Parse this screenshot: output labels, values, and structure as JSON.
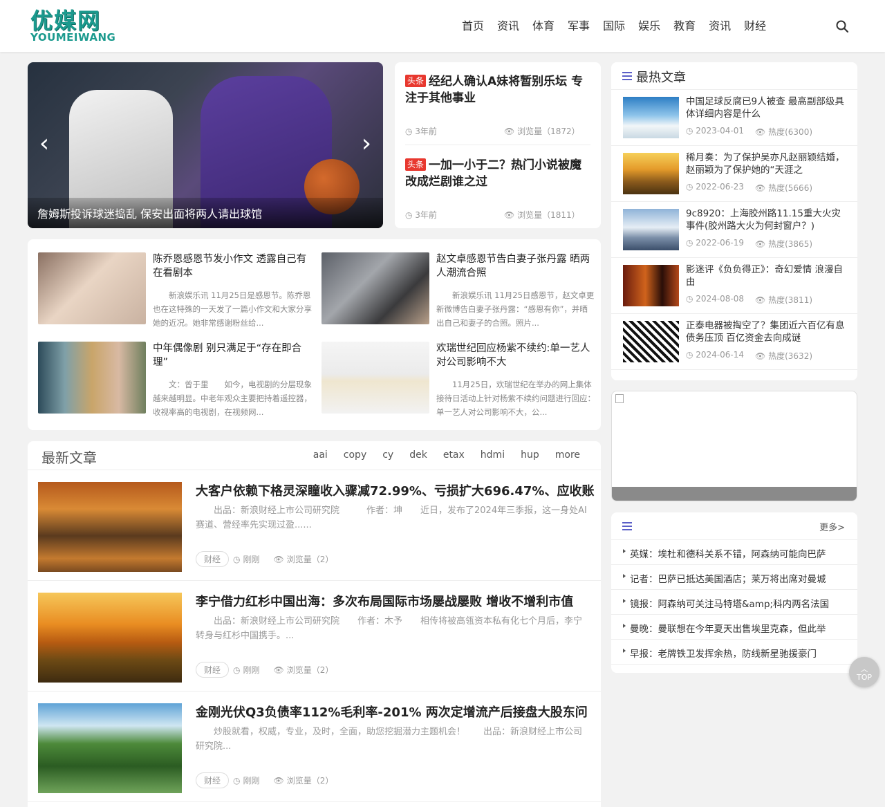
{
  "header": {
    "logo_cn": "优媒网",
    "logo_en": "YOUMEIWANG",
    "nav": [
      "首页",
      "资讯",
      "体育",
      "军事",
      "国际",
      "娱乐",
      "教育",
      "资讯",
      "财经"
    ]
  },
  "slider": {
    "caption": "詹姆斯投诉球迷捣乱 保安出面将两人请出球馆",
    "prev": "‹",
    "next": "›"
  },
  "headlines": [
    {
      "badge": "头条",
      "title": "经纪人确认A妹将暂别乐坛 专注于其他事业",
      "time": "3年前",
      "views": "浏览量（1872）"
    },
    {
      "badge": "头条",
      "title": "一加一小于二？热门小说被魔改成烂剧谁之过",
      "time": "3年前",
      "views": "浏览量（1811）"
    }
  ],
  "grid": [
    {
      "title": "陈乔恩感恩节发小作文 透露自己有在看剧本",
      "desc": "新浪娱乐讯 11月25日是感恩节。陈乔恩也在这特殊的一天发了一篇小作文和大家分享她的近况。她非常感谢粉丝给..."
    },
    {
      "title": "赵文卓感恩节告白妻子张丹露 晒两人潮流合照",
      "desc": "新浪娱乐讯 11月25日感恩节，赵文卓更新微博告白妻子张丹露：“感恩有你”，并晒出自己和妻子的合照。照片..."
    },
    {
      "title": "中年偶像剧 别只满足于“存在即合理”",
      "desc": "文：曾于里　　如今，电视剧的分层现象越来越明显。中老年观众主要把持着遥控器，收视率高的电视剧，在视频网..."
    },
    {
      "title": "欢瑞世纪回应杨紫不续约:单一艺人对公司影响不大",
      "desc": "11月25日，欢瑞世纪在举办的网上集体接待日活动上针对杨紫不续约问题进行回应：单一艺人对公司影响不大，公..."
    }
  ],
  "latest": {
    "title": "最新文章",
    "tabs": [
      "aai",
      "copy",
      "cy",
      "dek",
      "etax",
      "hdmi",
      "hup",
      "more"
    ],
    "articles": [
      {
        "title": "大客户依赖下格灵深瞳收入骤减72.99%、亏损扩大696.47%、应收账",
        "desc": "出品：新浪财经上市公司研究院　　　作者：坤　　近日，发布了2024年三季报，这一身处AI赛道、营经率先实现过盈......",
        "tag": "财经",
        "time": "刚刚",
        "views": "浏览量（2）"
      },
      {
        "title": "李宁借力红杉中国出海：多次布局国际市场屡战屡败 增收不增利市值",
        "desc": "出品：新浪财经上市公司研究院　　作者：木予　　相传将被高瓴资本私有化七个月后，李宁转身与红杉中国携手。...",
        "tag": "财经",
        "time": "刚刚",
        "views": "浏览量（2）"
      },
      {
        "title": "金刚光伏Q3负债率112%毛利率-201% 两次定增流产后接盘大股东问",
        "desc": "炒股就看，权威，专业，及时，全面，助您挖掘潜力主题机会！　　出品：新浪财经上市公司研究院...",
        "tag": "财经",
        "time": "刚刚",
        "views": "浏览量（2）"
      }
    ]
  },
  "hot": {
    "title": "最热文章",
    "items": [
      {
        "title": "中国足球反腐已9人被查 最高副部级具体详细内容是什么",
        "date": "2023-04-01",
        "heat": "热度(6300)"
      },
      {
        "title": "稀月奏：为了保护吴亦凡赵丽颖结婚，赵丽颖为了保护她的“天涯之",
        "date": "2022-06-23",
        "heat": "热度(5666)"
      },
      {
        "title": "9c8920：上海胶州路11.15重大火灾事件(胶州路大火为何封窗户？)",
        "date": "2022-06-19",
        "heat": "热度(3865)"
      },
      {
        "title": "影迷评《负负得正》：奇幻爱情 浪漫自由",
        "date": "2024-08-08",
        "heat": "热度(3811)"
      },
      {
        "title": "正泰电器被掏空了？集团近六百亿有息债务压顶 百亿资金去向成谜",
        "date": "2024-06-14",
        "heat": "热度(3632)"
      }
    ]
  },
  "news": {
    "more": "更多>",
    "items": [
      "英媒：埃杜和德科关系不错，阿森纳可能向巴萨",
      "记者：巴萨已抵达美国酒店；莱万将出席对曼城",
      "镜报：阿森纳可关注马特塔&amp;科内两名法国",
      "曼晚：曼联想在今年夏天出售埃里克森，但此举",
      "早报：老牌铁卫发挥余热，防线新星驰援豪门"
    ]
  },
  "top_btn": "TOP",
  "colors": {
    "accent": "#5b5fc7",
    "badge": "#e8382f",
    "logo": "#1b9a8e"
  }
}
